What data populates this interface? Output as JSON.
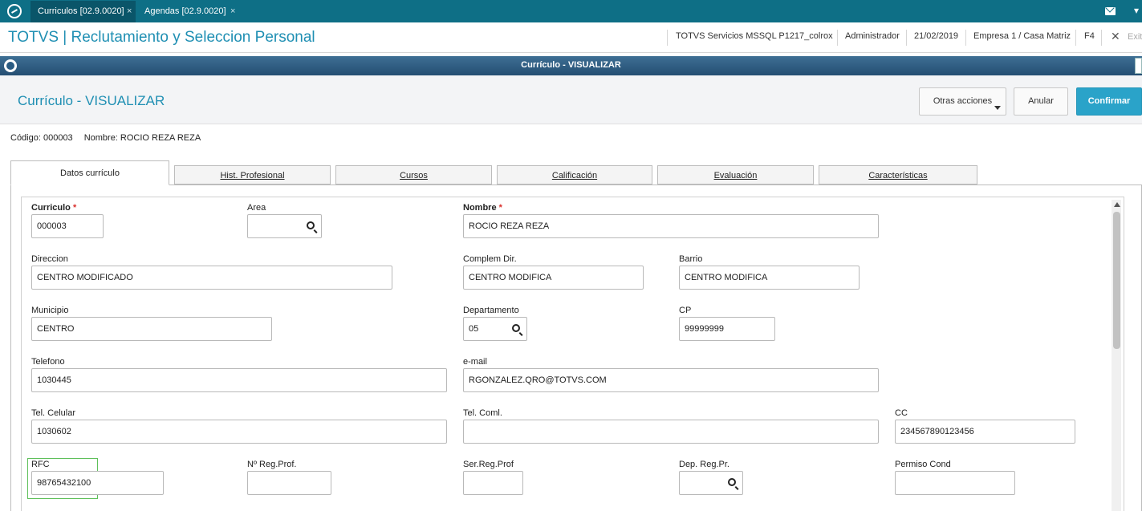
{
  "topbar": {
    "tabs": [
      {
        "label": "Curriculos [02.9.0020]",
        "active": true
      },
      {
        "label": "Agendas [02.9.0020]",
        "active": false
      }
    ],
    "close_glyph": "×"
  },
  "header": {
    "title": "TOTVS | Reclutamiento y Seleccion Personal",
    "environment": "TOTVS Servicios MSSQL P1217_colrox",
    "user": "Administrador",
    "date": "21/02/2019",
    "company": "Empresa 1 / Casa Matriz",
    "help_key": "F4",
    "exit_label": "Exit"
  },
  "window": {
    "title": "Currículo - VISUALIZAR"
  },
  "form": {
    "title": "Currículo - VISUALIZAR",
    "buttons": {
      "other_actions": "Otras acciones",
      "cancel": "Anular",
      "confirm": "Confirmar"
    },
    "info": {
      "code": "Código: 000003",
      "name": "Nombre: ROCIO REZA REZA"
    },
    "tabs": [
      {
        "label": "Datos currículo",
        "active": true
      },
      {
        "label": "Hist. Profesional",
        "active": false
      },
      {
        "label": "Cursos",
        "active": false
      },
      {
        "label": "Calificación",
        "active": false
      },
      {
        "label": "Evaluación",
        "active": false
      },
      {
        "label": "Características",
        "active": false
      }
    ],
    "required_marker": "*",
    "fields": {
      "curriculo": {
        "label": "Curriculo",
        "value": "000003"
      },
      "area": {
        "label": "Area",
        "value": ""
      },
      "nombre": {
        "label": "Nombre",
        "value": "ROCIO REZA REZA"
      },
      "direccion": {
        "label": "Direccion",
        "value": "CENTRO MODIFICADO"
      },
      "complem_dir": {
        "label": "Complem Dir.",
        "value": "CENTRO MODIFICA"
      },
      "barrio": {
        "label": "Barrio",
        "value": "CENTRO MODIFICA"
      },
      "municipio": {
        "label": "Municipio",
        "value": "CENTRO"
      },
      "departamento": {
        "label": "Departamento",
        "value": "05"
      },
      "cp": {
        "label": "CP",
        "value": "99999999"
      },
      "telefono": {
        "label": "Telefono",
        "value": "1030445"
      },
      "email": {
        "label": "e-mail",
        "value": "RGONZALEZ.QRO@TOTVS.COM"
      },
      "tel_celular": {
        "label": "Tel. Celular",
        "value": "1030602"
      },
      "tel_coml": {
        "label": "Tel. Coml.",
        "value": ""
      },
      "cc": {
        "label": "CC",
        "value": "234567890123456"
      },
      "rfc": {
        "label": "RFC",
        "value": "98765432100"
      },
      "reg_prof": {
        "label": "Nº Reg.Prof.",
        "value": ""
      },
      "ser_reg_prof": {
        "label": "Ser.Reg.Prof",
        "value": ""
      },
      "dep_reg_pr": {
        "label": "Dep. Reg.Pr.",
        "value": ""
      },
      "permiso_cond": {
        "label": "Permiso Cond",
        "value": ""
      }
    }
  },
  "colors": {
    "topbar": "#0e6f86",
    "accent": "#1f8fb3",
    "confirm_button": "#2aa3c9",
    "window_title": "#2f5f86",
    "focus_highlight": "#5ec05a",
    "required": "#d9302c"
  }
}
